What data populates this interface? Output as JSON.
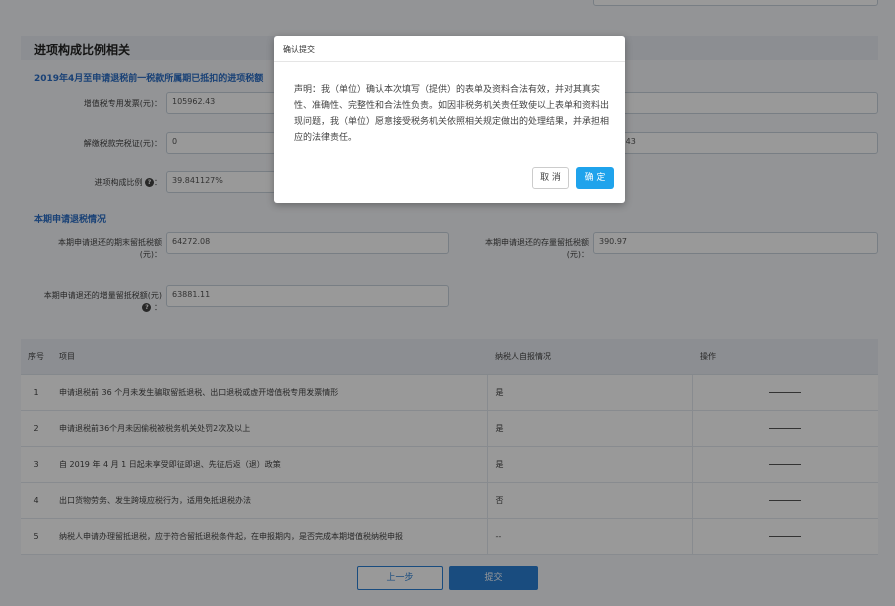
{
  "section": {
    "title": "进项构成比例相关",
    "sub1_title": "2019年4月至申请退税前一税款所属期已抵扣的进项税额",
    "sub2_title": "本期申请退税情况"
  },
  "fields": {
    "vat_invoice_label": "增值税专用发票(元)：",
    "vat_invoice_value": "105962.43",
    "customs_label": "解缴税款完税证(元)：",
    "customs_value": "0",
    "right_partial_value": "2.43",
    "ratio_label": "进项构成比例",
    "ratio_value": "39.841127%",
    "period_end_label_line1": "本期申请退还的期末留抵税额",
    "period_end_label_line2": "(元)：",
    "period_end_value": "64272.08",
    "stock_label_line1": "本期申请退还的存量留抵税额",
    "stock_label_line2": "(元)：",
    "stock_value": "390.97",
    "increment_label": "本期申请退还的增量留抵税额(元)",
    "increment_value": "63881.11",
    "help_glyph": "?",
    "colon": "："
  },
  "table": {
    "headers": [
      "序号",
      "项目",
      "纳税人自报情况",
      "操作"
    ],
    "rows": [
      {
        "idx": "1",
        "item": "申请退税前 36 个月未发生骗取留抵退税、出口退税或虚开增值税专用发票情形",
        "answer": "是"
      },
      {
        "idx": "2",
        "item": "申请退税前36个月未因偷税被税务机关处罚2次及以上",
        "answer": "是"
      },
      {
        "idx": "3",
        "item": "自 2019 年 4 月 1 日起未享受即征即退、先征后返（退）政策",
        "answer": "是"
      },
      {
        "idx": "4",
        "item": "出口货物劳务、发生跨境应税行为，适用免抵退税办法",
        "answer": "否"
      },
      {
        "idx": "5",
        "item": "纳税人申请办理留抵退税，应于符合留抵退税条件起，在申报期内，是否完成本期增值税纳税申报",
        "answer": "--"
      }
    ]
  },
  "buttons": {
    "prev": "上一步",
    "submit": "提交"
  },
  "modal": {
    "title": "确认提交",
    "body": "声明：我（单位）确认本次填写（提供）的表单及资料合法有效，并对其真实性、准确性、完整性和合法性负责。如因非税务机关责任致使以上表单和资料出现问题，我（单位）愿意接受税务机关依照相关规定做出的处理结果，并承担相应的法律责任。",
    "cancel": "取 消",
    "ok": "确 定"
  },
  "colors": {
    "accent": "#2a7fd4",
    "modal_ok": "#1fa3ec",
    "subtitle": "#2a6dc5"
  }
}
